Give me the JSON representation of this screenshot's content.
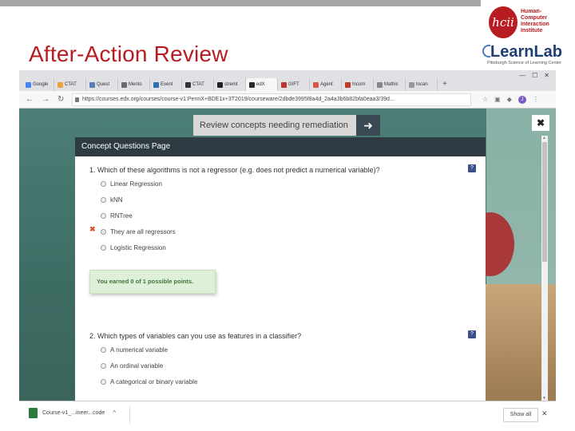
{
  "slide": {
    "title": "After-Action Review",
    "colors": {
      "title": "#b81c22",
      "topbar": "#a6a6a6"
    }
  },
  "logos": {
    "hcii": {
      "mark": "hcii",
      "text": "Human-\nComputer\nInteraction\nInstitute"
    },
    "learnlab": {
      "name": "LearnLab",
      "subtitle": "Pittsburgh Science of Learning Center"
    }
  },
  "browser": {
    "window_controls": [
      "—",
      "☐",
      "✕"
    ],
    "tabs": [
      {
        "label": "Google",
        "color": "#4285f4"
      },
      {
        "label": "CTAT",
        "color": "#e8a33d"
      },
      {
        "label": "Quest",
        "color": "#5b7fb5"
      },
      {
        "label": "Mento",
        "color": "#6c6c6c"
      },
      {
        "label": "Event",
        "color": "#2a6fb0"
      },
      {
        "label": "CTAT",
        "color": "#333333"
      },
      {
        "label": "stremt",
        "color": "#222222"
      },
      {
        "label": "edX",
        "color": "#2b2b2b",
        "active": true
      },
      {
        "label": "GIFT",
        "color": "#b33"
      },
      {
        "label": "Agent",
        "color": "#d9534f"
      },
      {
        "label": "Incom",
        "color": "#c0392b"
      },
      {
        "label": "Mathis",
        "color": "#888888"
      },
      {
        "label": "Iocan",
        "color": "#999999"
      }
    ],
    "new_tab": "+",
    "nav": {
      "back": "←",
      "forward": "→",
      "reload": "↻"
    },
    "url": "https://courses.edx.org/courses/course-v1:PennX+BDE1x+3T2019/courseware/2dbde3995f8a4d_2a4a3b6b82bfa0eaa3/39d...",
    "extensions": {
      "star": "☆",
      "ext1": "▣",
      "ext2": "◆",
      "avatar": "J",
      "menu": "⋮"
    }
  },
  "page": {
    "remediate_button": "Review concepts needing remediation",
    "remediate_arrow": "➜",
    "close": "✖",
    "panel_title": "Concept Questions Page",
    "help": "?",
    "q1": {
      "title": "1. Which of these algorithms is not a regressor (e.g. does not predict a numerical variable)?",
      "options": [
        "Linear Regression",
        "kNN",
        "RNTree",
        "They are all regressors",
        "Logistic Regression"
      ],
      "selected_index": 3,
      "wrong_mark": "✖",
      "feedback": "You earned 0 of 1 possible points."
    },
    "q2": {
      "title": "2. Which types of variables can you use as features in a classifier?",
      "options": [
        "A numerical variable",
        "An ordinal variable",
        "A categorical or binary variable"
      ]
    }
  },
  "downloads": {
    "file": "Course-v1_...ineer...code",
    "chevron": "^",
    "show_all": "Show all",
    "close": "✕"
  }
}
